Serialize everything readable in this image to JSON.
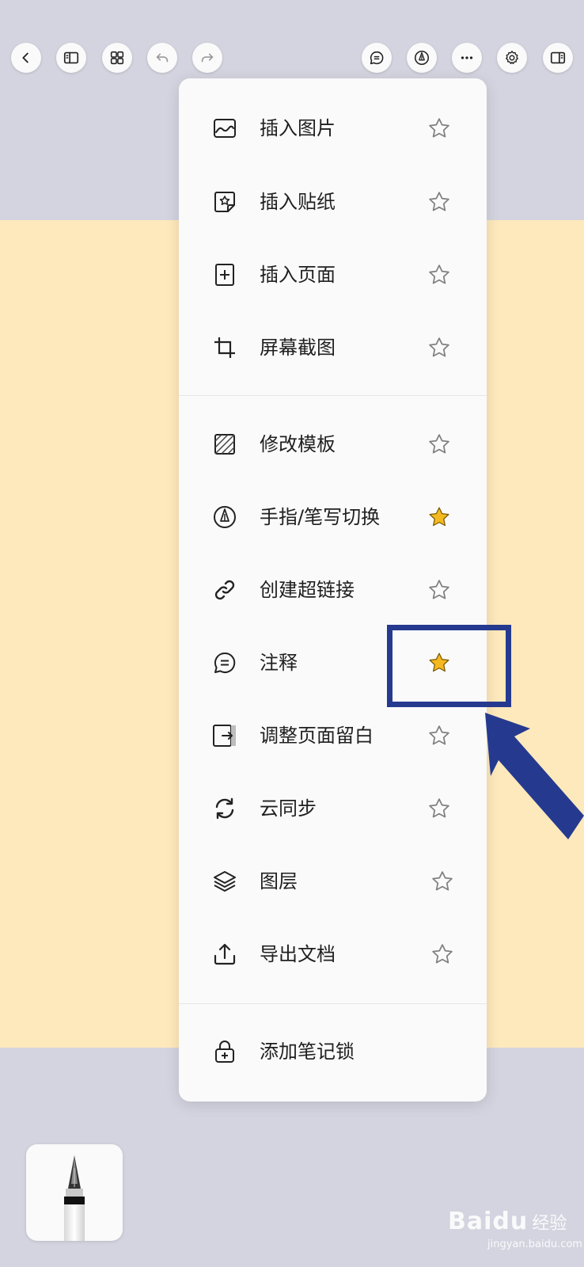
{
  "toolbar": {
    "left_buttons": [
      "back-icon",
      "sidebar-icon",
      "grid-icon",
      "undo-icon",
      "redo-icon"
    ],
    "right_buttons": [
      "comment-icon",
      "pen-nib-icon",
      "more-icon",
      "gear-icon",
      "panel-icon"
    ]
  },
  "menu": {
    "section1": [
      {
        "label": "插入图片",
        "icon": "image-icon",
        "starred": false
      },
      {
        "label": "插入贴纸",
        "icon": "sticker-icon",
        "starred": false
      },
      {
        "label": "插入页面",
        "icon": "add-page-icon",
        "starred": false
      },
      {
        "label": "屏幕截图",
        "icon": "crop-icon",
        "starred": false
      }
    ],
    "section2": [
      {
        "label": "修改模板",
        "icon": "template-icon",
        "starred": false
      },
      {
        "label": "手指/笔写切换",
        "icon": "pen-nib-icon",
        "starred": true
      },
      {
        "label": "创建超链接",
        "icon": "link-icon",
        "starred": false
      },
      {
        "label": "注释",
        "icon": "comment-icon",
        "starred": true
      },
      {
        "label": "调整页面留白",
        "icon": "margin-icon",
        "starred": false
      },
      {
        "label": "云同步",
        "icon": "sync-icon",
        "starred": false
      },
      {
        "label": "图层",
        "icon": "layers-icon",
        "starred": false
      },
      {
        "label": "导出文档",
        "icon": "export-icon",
        "starred": false
      }
    ],
    "section3": [
      {
        "label": "添加笔记锁",
        "icon": "lock-icon"
      }
    ]
  },
  "colors": {
    "star_active": "#f5b920",
    "star_inactive": "#808080",
    "annotation": "#253a8f",
    "paper": "#fee9bc",
    "background": "#d3d4df"
  },
  "watermark": {
    "main": "Baidu",
    "sub": "经验",
    "url": "jingyan.baidu.com"
  }
}
